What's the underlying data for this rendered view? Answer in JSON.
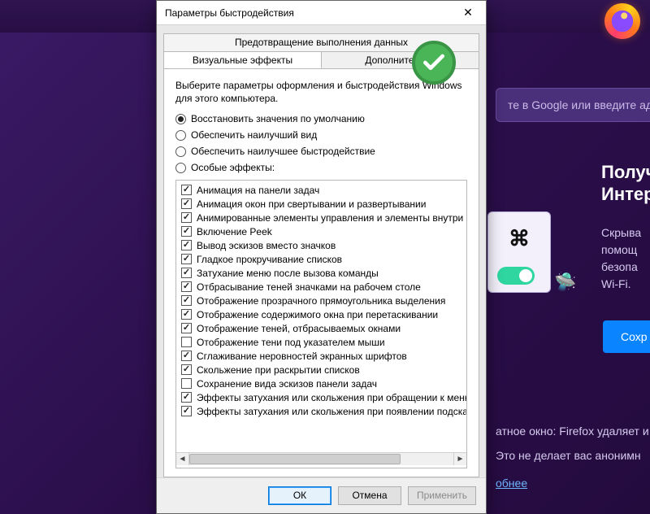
{
  "firefox": {
    "search_placeholder": "те в Google или введите адр",
    "heading1": "Получ",
    "heading2": "Интер",
    "body1": "Скрыва",
    "body2": "помощ",
    "body3": "безопа",
    "body4": "Wi-Fi.",
    "cta": "Сохр",
    "note1": "атное окно: Firefox удаляет и",
    "note2": "Это не делает вас анонимн",
    "more": "обнее",
    "rocket": "🛸"
  },
  "dialog": {
    "title": "Параметры быстродействия",
    "tab_outer": "Предотвращение выполнения данных",
    "tab_visual": "Визуальные эффекты",
    "tab_advanced": "Дополнительно",
    "desc": "Выберите параметры оформления и быстродействия Windows для этого компьютера.",
    "radios": [
      {
        "label": "Восстановить значения по умолчанию",
        "checked": true
      },
      {
        "label": "Обеспечить наилучший вид",
        "checked": false
      },
      {
        "label": "Обеспечить наилучшее быстродействие",
        "checked": false
      },
      {
        "label": "Особые эффекты:",
        "checked": false
      }
    ],
    "effects": [
      {
        "label": "Анимация на панели задач",
        "checked": true
      },
      {
        "label": "Анимация окон при свертывании и развертывании",
        "checked": true
      },
      {
        "label": "Анимированные элементы управления и элементы внутри окн",
        "checked": true
      },
      {
        "label": "Включение Peek",
        "checked": true
      },
      {
        "label": "Вывод эскизов вместо значков",
        "checked": true
      },
      {
        "label": "Гладкое прокручивание списков",
        "checked": true
      },
      {
        "label": "Затухание меню после вызова команды",
        "checked": true
      },
      {
        "label": "Отбрасывание теней значками на рабочем столе",
        "checked": true
      },
      {
        "label": "Отображение прозрачного прямоугольника выделения",
        "checked": true
      },
      {
        "label": "Отображение содержимого окна при перетаскивании",
        "checked": true
      },
      {
        "label": "Отображение теней, отбрасываемых окнами",
        "checked": true
      },
      {
        "label": "Отображение тени под указателем мыши",
        "checked": false
      },
      {
        "label": "Сглаживание неровностей экранных шрифтов",
        "checked": true
      },
      {
        "label": "Скольжение при раскрытии списков",
        "checked": true
      },
      {
        "label": "Сохранение вида эскизов панели задач",
        "checked": false
      },
      {
        "label": "Эффекты затухания или скольжения при обращении к меню",
        "checked": true
      },
      {
        "label": "Эффекты затухания или скольжения при появлении подсказок",
        "checked": true
      }
    ],
    "ok": "ОК",
    "cancel": "Отмена",
    "apply": "Применить"
  }
}
